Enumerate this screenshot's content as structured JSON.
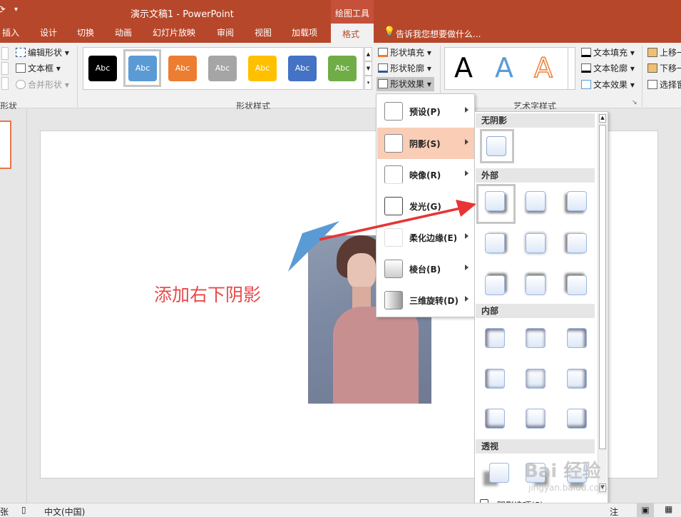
{
  "title_bar": {
    "document_title": "演示文稿1 - PowerPoint",
    "contextual_group": "绘图工具",
    "colors": {
      "accent": "#b7472a",
      "contextual": "#c5513a"
    }
  },
  "tabs": [
    "插入",
    "设计",
    "切换",
    "动画",
    "幻灯片放映",
    "审阅",
    "视图",
    "加载项",
    "格式"
  ],
  "active_tab": "格式",
  "tell_me": "告诉我您想要做什么...",
  "ribbon": {
    "insert_shapes": {
      "edit_shape": "编辑形状",
      "text_box": "文本框",
      "merge_shapes": "合并形状",
      "group_label_partial": "形状"
    },
    "shape_styles": {
      "swatches": [
        {
          "label": "Abc",
          "color": "#000000"
        },
        {
          "label": "Abc",
          "color": "#5b9bd5"
        },
        {
          "label": "Abc",
          "color": "#ed7d31"
        },
        {
          "label": "Abc",
          "color": "#a5a5a5"
        },
        {
          "label": "Abc",
          "color": "#ffc000"
        },
        {
          "label": "Abc",
          "color": "#4472c4"
        },
        {
          "label": "Abc",
          "color": "#70ad47"
        }
      ],
      "fill": "形状填充",
      "outline": "形状轮廓",
      "effects": "形状效果",
      "group_label": "形状样式"
    },
    "wordart": {
      "letters": [
        "A",
        "A",
        "A"
      ],
      "text_fill": "文本填充",
      "text_outline": "文本轮廓",
      "text_effects": "文本效果",
      "group_label": "艺术字样式"
    },
    "arrange": {
      "bring_forward": "上移一",
      "send_backward": "下移一",
      "selection_pane": "选择窗"
    }
  },
  "effects_menu": [
    {
      "label": "预设(P)"
    },
    {
      "label": "阴影(S)"
    },
    {
      "label": "映像(R)"
    },
    {
      "label": "发光(G)"
    },
    {
      "label": "柔化边缘(E)"
    },
    {
      "label": "棱台(B)"
    },
    {
      "label": "三维旋转(D)"
    }
  ],
  "shadow_gallery": {
    "sections": [
      "无阴影",
      "外部",
      "内部",
      "透视"
    ],
    "options": "阴影选项(S)..."
  },
  "slide": {
    "caption": "添加右下阴影",
    "caption_color": "#e84a4a"
  },
  "status_bar": {
    "slide_count_partial": "张",
    "language": "中文(中国)",
    "notes_partial": "注"
  },
  "watermark": {
    "brand": "Bai 经验",
    "url": "jingyan.baidu.com"
  }
}
